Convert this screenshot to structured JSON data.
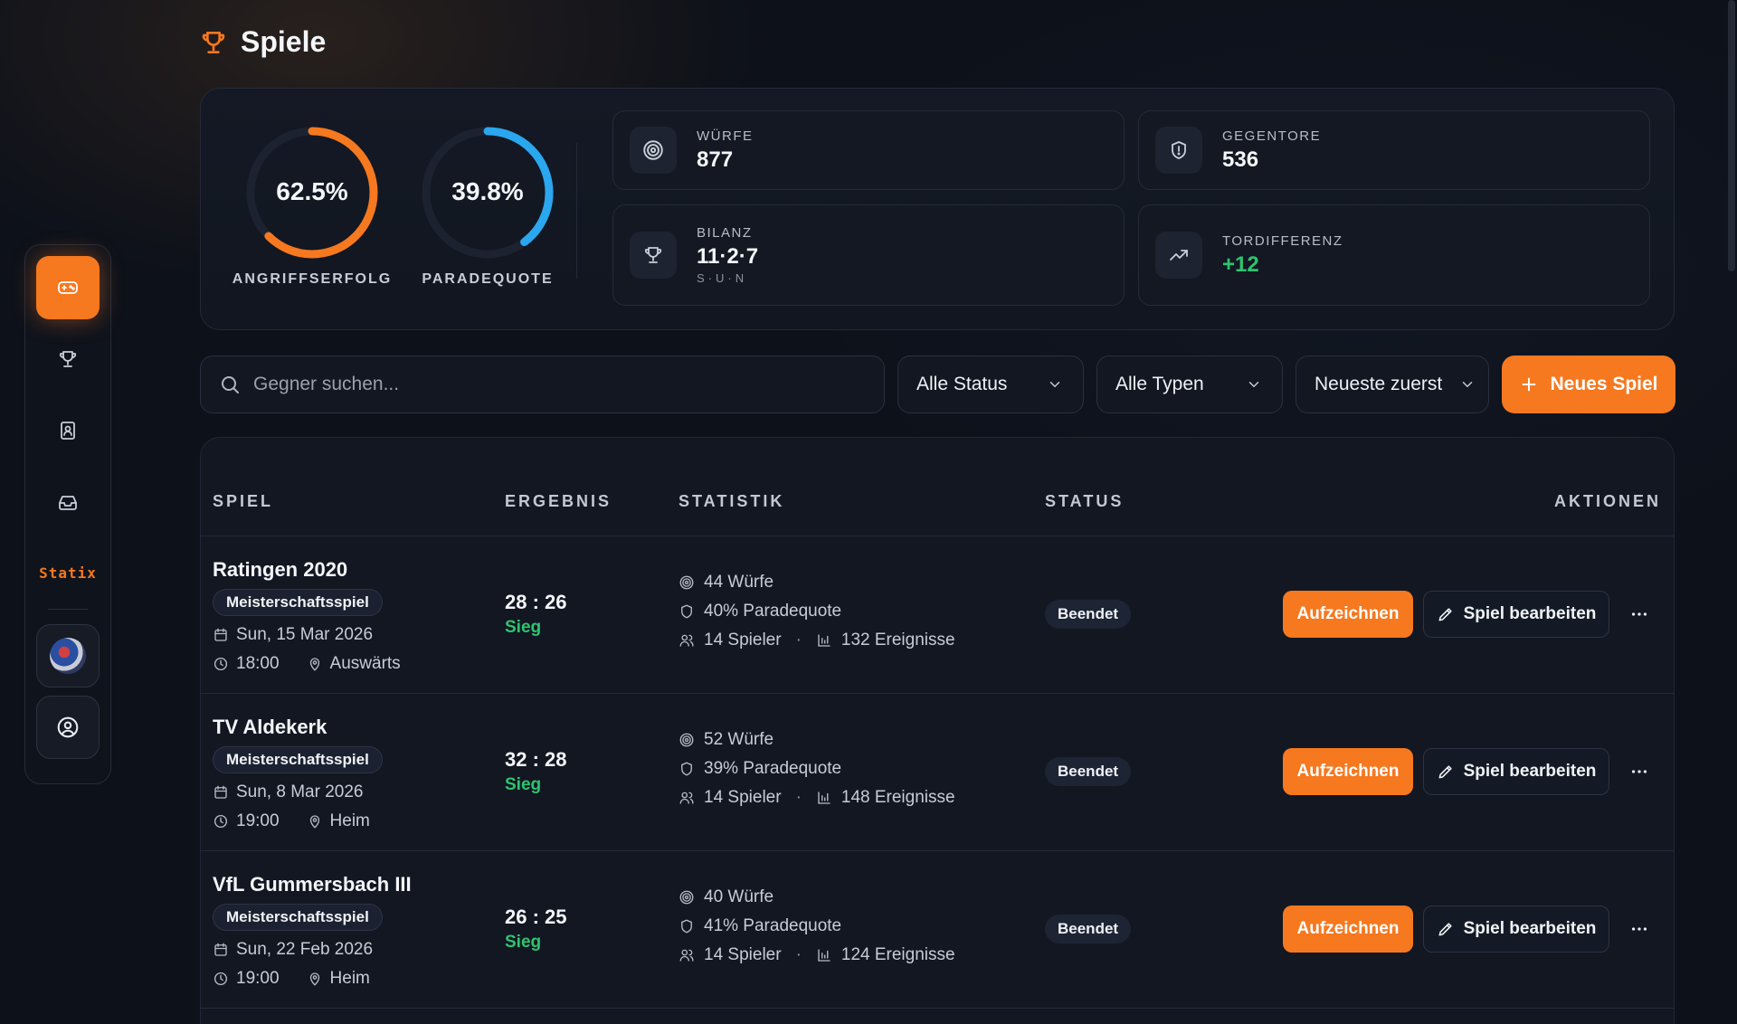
{
  "header": {
    "title": "Spiele",
    "icon": "trophy-icon"
  },
  "sidebar": {
    "items": [
      {
        "name": "games",
        "icon": "gamepad-icon",
        "active": true
      },
      {
        "name": "trophies",
        "icon": "trophy-icon"
      },
      {
        "name": "contacts",
        "icon": "contact-book-icon"
      },
      {
        "name": "inbox",
        "icon": "inbox-icon"
      }
    ],
    "logo_text": "Statix",
    "team_avatar": "team-logo",
    "profile_icon": "user-circle-icon"
  },
  "stats": {
    "rings": [
      {
        "value": "62.5%",
        "fraction": 0.625,
        "label": "ANGRIFFSERFOLG",
        "color": "#f6781f"
      },
      {
        "value": "39.8%",
        "fraction": 0.398,
        "label": "PARADEQUOTE",
        "color": "#2aa7ee"
      }
    ],
    "cards": [
      {
        "label": "WÜRFE",
        "value": "877",
        "icon": "target-icon"
      },
      {
        "label": "GEGENTORE",
        "value": "536",
        "icon": "shield-icon"
      },
      {
        "label": "BILANZ",
        "value": "11·2·7",
        "sub": "S·U·N",
        "icon": "trophy-icon"
      },
      {
        "label": "TORDIFFERENZ",
        "value": "+12",
        "icon": "trend-up-icon"
      }
    ]
  },
  "toolbar": {
    "search_placeholder": "Gegner suchen...",
    "status_filter": "Alle Status",
    "type_filter": "Alle Typen",
    "sort": "Neueste zuerst",
    "new_game": "Neues Spiel"
  },
  "table": {
    "columns": [
      "SPIEL",
      "ERGEBNIS",
      "STATISTIK",
      "STATUS",
      "AKTIONEN"
    ],
    "rows": [
      {
        "opponent": "Ratingen 2020",
        "type": "Meisterschaftsspiel",
        "date": "Sun, 15 Mar 2026",
        "time": "18:00",
        "venue": "Auswärts",
        "score": "28 : 26",
        "result": "Sieg",
        "shots": "44 Würfe",
        "save_rate": "40% Paradequote",
        "players": "14 Spieler",
        "events": "132 Ereignisse",
        "status": "Beendet",
        "record": "Aufzeichnen",
        "edit": "Spiel bearbeiten"
      },
      {
        "opponent": "TV Aldekerk",
        "type": "Meisterschaftsspiel",
        "date": "Sun, 8 Mar 2026",
        "time": "19:00",
        "venue": "Heim",
        "score": "32 : 28",
        "result": "Sieg",
        "shots": "52 Würfe",
        "save_rate": "39% Paradequote",
        "players": "14 Spieler",
        "events": "148 Ereignisse",
        "status": "Beendet",
        "record": "Aufzeichnen",
        "edit": "Spiel bearbeiten"
      },
      {
        "opponent": "VfL Gummersbach III",
        "type": "Meisterschaftsspiel",
        "date": "Sun, 22 Feb 2026",
        "time": "19:00",
        "venue": "Heim",
        "score": "26 : 25",
        "result": "Sieg",
        "shots": "40 Würfe",
        "save_rate": "41% Paradequote",
        "players": "14 Spieler",
        "events": "124 Ereignisse",
        "status": "Beendet",
        "record": "Aufzeichnen",
        "edit": "Spiel bearbeiten"
      }
    ]
  },
  "colors": {
    "accent": "#f6781f",
    "success": "#2ec46f",
    "info": "#2aa7ee"
  }
}
